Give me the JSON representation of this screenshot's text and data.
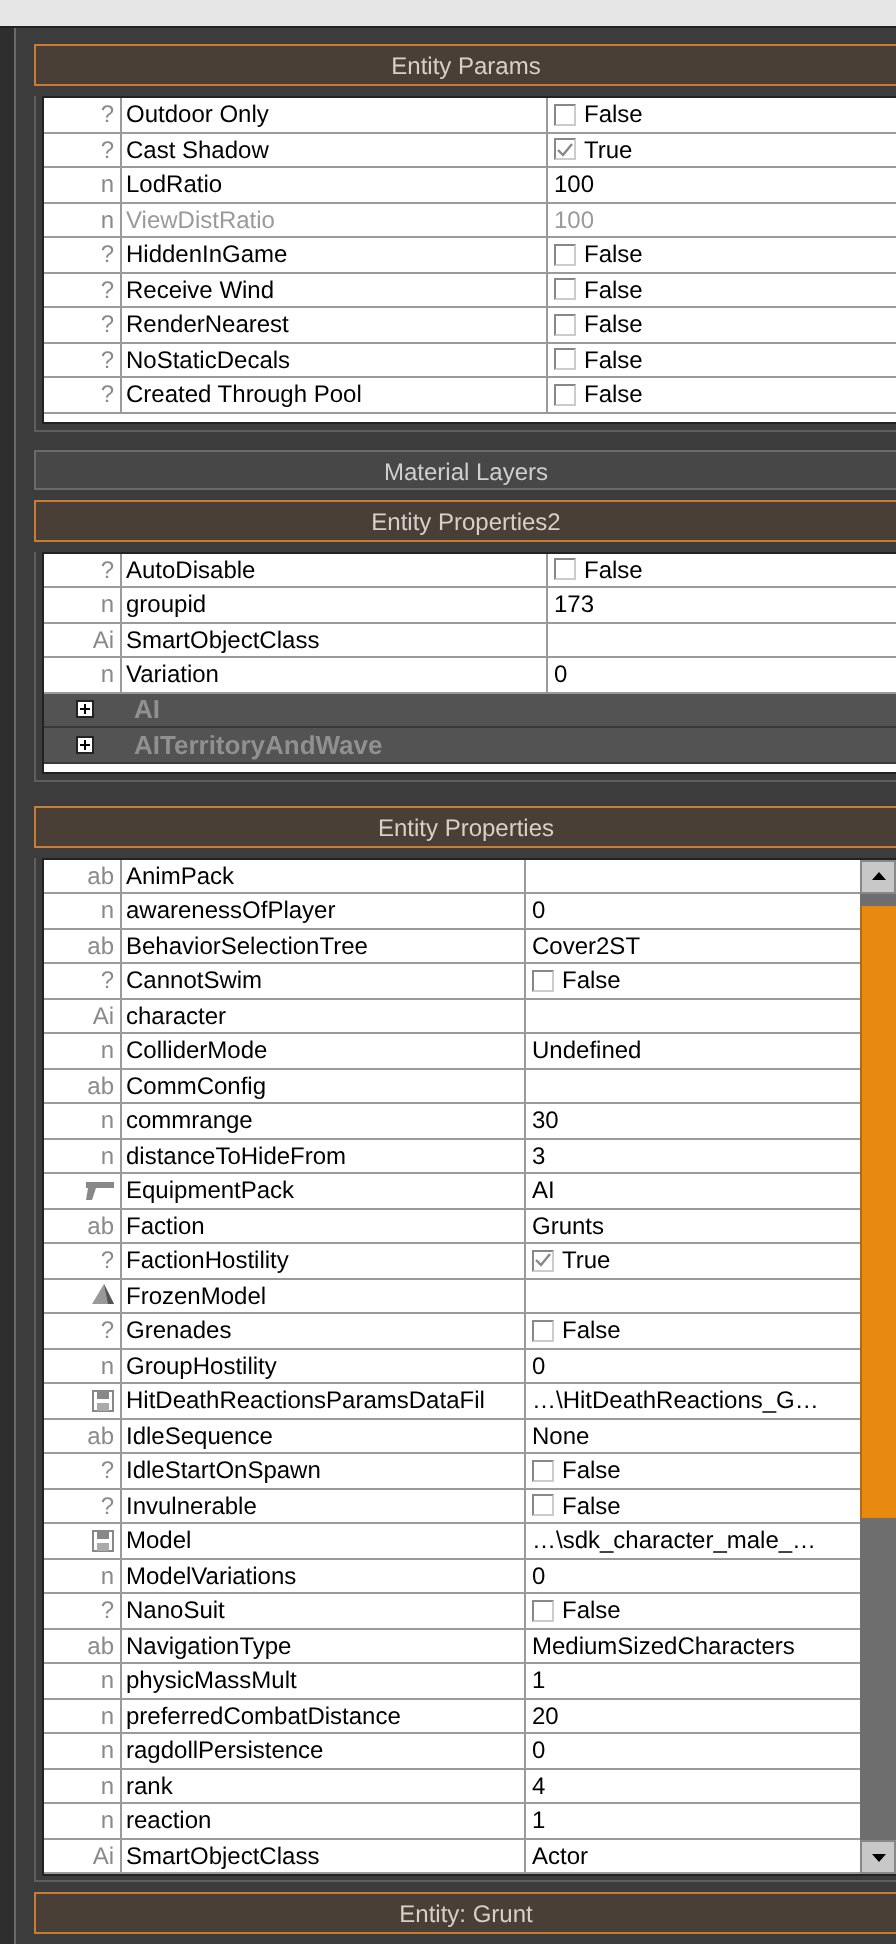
{
  "sections": [
    {
      "title": "Entity Params",
      "expanded": true,
      "rows": [
        {
          "glyph": "?",
          "name": "Outdoor Only",
          "kind": "bool",
          "checked": false,
          "value": "False",
          "disabled": false
        },
        {
          "glyph": "?",
          "name": "Cast Shadow",
          "kind": "bool",
          "checked": true,
          "value": "True",
          "disabled": false
        },
        {
          "glyph": "n",
          "name": "LodRatio",
          "kind": "text",
          "value": "100",
          "disabled": false
        },
        {
          "glyph": "n",
          "name": "ViewDistRatio",
          "kind": "text",
          "value": "100",
          "disabled": true
        },
        {
          "glyph": "?",
          "name": "HiddenInGame",
          "kind": "bool",
          "checked": false,
          "value": "False",
          "disabled": false
        },
        {
          "glyph": "?",
          "name": "Receive Wind",
          "kind": "bool",
          "checked": false,
          "value": "False",
          "disabled": false
        },
        {
          "glyph": "?",
          "name": "RenderNearest",
          "kind": "bool",
          "checked": false,
          "value": "False",
          "disabled": false
        },
        {
          "glyph": "?",
          "name": "NoStaticDecals",
          "kind": "bool",
          "checked": false,
          "value": "False",
          "disabled": false
        },
        {
          "glyph": "?",
          "name": "Created Through Pool",
          "kind": "bool",
          "checked": false,
          "value": "False",
          "disabled": false
        }
      ]
    },
    {
      "title": "Material Layers",
      "expanded": false
    },
    {
      "title": "Entity Properties2",
      "expanded": true,
      "rows": [
        {
          "glyph": "?",
          "name": "AutoDisable",
          "kind": "bool",
          "checked": false,
          "value": "False"
        },
        {
          "glyph": "n",
          "name": "groupid",
          "kind": "text",
          "value": "173"
        },
        {
          "glyph": "Ai",
          "name": "SmartObjectClass",
          "kind": "text"
        },
        {
          "glyph": "n",
          "name": "Variation",
          "kind": "text",
          "value": "0"
        },
        {
          "kind": "group",
          "name": "AI",
          "expanded": false
        },
        {
          "kind": "group",
          "name": "AITerritoryAndWave",
          "expanded": false
        }
      ]
    },
    {
      "title": "Entity Properties",
      "expanded": true,
      "scrollbar": true,
      "rows": [
        {
          "glyph": "ab",
          "name": "AnimPack",
          "kind": "text"
        },
        {
          "glyph": "n",
          "name": "awarenessOfPlayer",
          "kind": "text",
          "value": "0"
        },
        {
          "glyph": "ab",
          "name": "BehaviorSelectionTree",
          "kind": "text",
          "value": "Cover2ST"
        },
        {
          "glyph": "?",
          "name": "CannotSwim",
          "kind": "bool",
          "checked": false,
          "value": "False"
        },
        {
          "glyph": "Ai",
          "name": "character",
          "kind": "text"
        },
        {
          "glyph": "n",
          "name": "ColliderMode",
          "kind": "text",
          "value": "Undefined"
        },
        {
          "glyph": "ab",
          "name": "CommConfig",
          "kind": "text"
        },
        {
          "glyph": "n",
          "name": "commrange",
          "kind": "text",
          "value": "30"
        },
        {
          "glyph": "n",
          "name": "distanceToHideFrom",
          "kind": "text",
          "value": "3"
        },
        {
          "name": "EquipmentPack",
          "kind": "equipment",
          "value": "AI"
        },
        {
          "glyph": "ab",
          "name": "Faction",
          "kind": "text",
          "value": "Grunts"
        },
        {
          "glyph": "?",
          "name": "FactionHostility",
          "kind": "bool",
          "checked": true,
          "value": "True"
        },
        {
          "name": "FrozenModel",
          "kind": "model"
        },
        {
          "glyph": "?",
          "name": "Grenades",
          "kind": "bool",
          "checked": false,
          "value": "False"
        },
        {
          "glyph": "n",
          "name": "GroupHostility",
          "kind": "text",
          "value": "0"
        },
        {
          "name": "HitDeathReactionsParamsDataFil",
          "kind": "file",
          "value": "…\\HitDeathReactions_G…"
        },
        {
          "glyph": "ab",
          "name": "IdleSequence",
          "kind": "text",
          "value": "None"
        },
        {
          "glyph": "?",
          "name": "IdleStartOnSpawn",
          "kind": "bool",
          "checked": false,
          "value": "False"
        },
        {
          "glyph": "?",
          "name": "Invulnerable",
          "kind": "bool",
          "checked": false,
          "value": "False"
        },
        {
          "name": "Model",
          "kind": "file",
          "value": "…\\sdk_character_male_…"
        },
        {
          "glyph": "n",
          "name": "ModelVariations",
          "kind": "text",
          "value": "0"
        },
        {
          "glyph": "?",
          "name": "NanoSuit",
          "kind": "bool",
          "checked": false,
          "value": "False"
        },
        {
          "glyph": "ab",
          "name": "NavigationType",
          "kind": "text",
          "value": "MediumSizedCharacters"
        },
        {
          "glyph": "n",
          "name": "physicMassMult",
          "kind": "text",
          "value": "1"
        },
        {
          "glyph": "n",
          "name": "preferredCombatDistance",
          "kind": "text",
          "value": "20"
        },
        {
          "glyph": "n",
          "name": "ragdollPersistence",
          "kind": "text",
          "value": "0"
        },
        {
          "glyph": "n",
          "name": "rank",
          "kind": "text",
          "value": "4"
        },
        {
          "glyph": "n",
          "name": "reaction",
          "kind": "text",
          "value": "1"
        },
        {
          "glyph": "Ai",
          "name": "SmartObjectClass",
          "kind": "text",
          "value": "Actor"
        }
      ]
    },
    {
      "title": "Entity: Grunt",
      "expanded": true
    }
  ]
}
